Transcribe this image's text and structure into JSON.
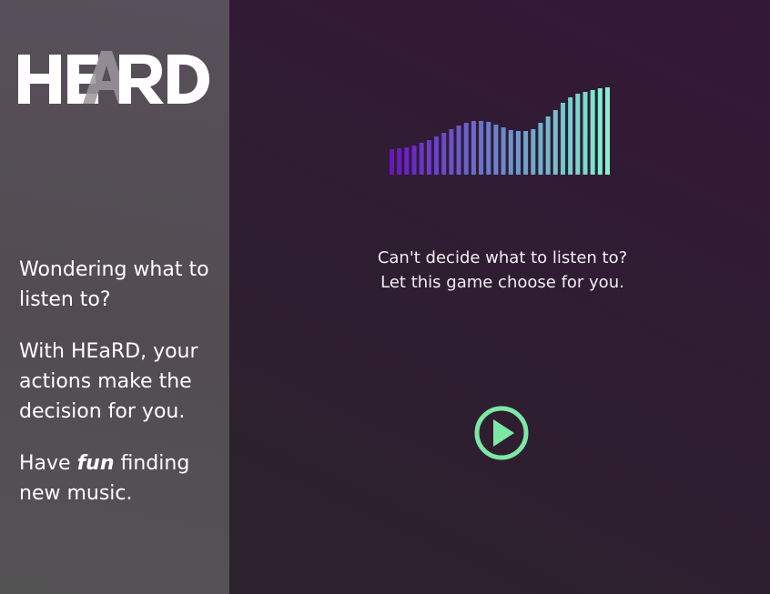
{
  "brand": {
    "name": "HEARD",
    "accent_color": "#7de8a4"
  },
  "sidebar": {
    "intro_line": "Wondering what to listen to?",
    "actions_line": "With HEaRD, your actions make the decision for you.",
    "fun_prefix": "Have",
    "fun_word": "fun",
    "fun_suffix": "finding new music."
  },
  "main": {
    "tagline_line1": "Can't decide what to listen to?",
    "tagline_line2": "Let this game choose for you.",
    "equalizer": {
      "levels": [
        0.28,
        0.29,
        0.3,
        0.32,
        0.35,
        0.38,
        0.42,
        0.46,
        0.5,
        0.54,
        0.57,
        0.59,
        0.59,
        0.58,
        0.55,
        0.52,
        0.49,
        0.48,
        0.48,
        0.5,
        0.57,
        0.64,
        0.71,
        0.79,
        0.85,
        0.89,
        0.91,
        0.93,
        0.95,
        0.96
      ],
      "color_start": "#6a14c6",
      "color_mid": "#6a87cc",
      "color_end": "#7ef5cd"
    },
    "play_icon": "play-circle-icon"
  }
}
